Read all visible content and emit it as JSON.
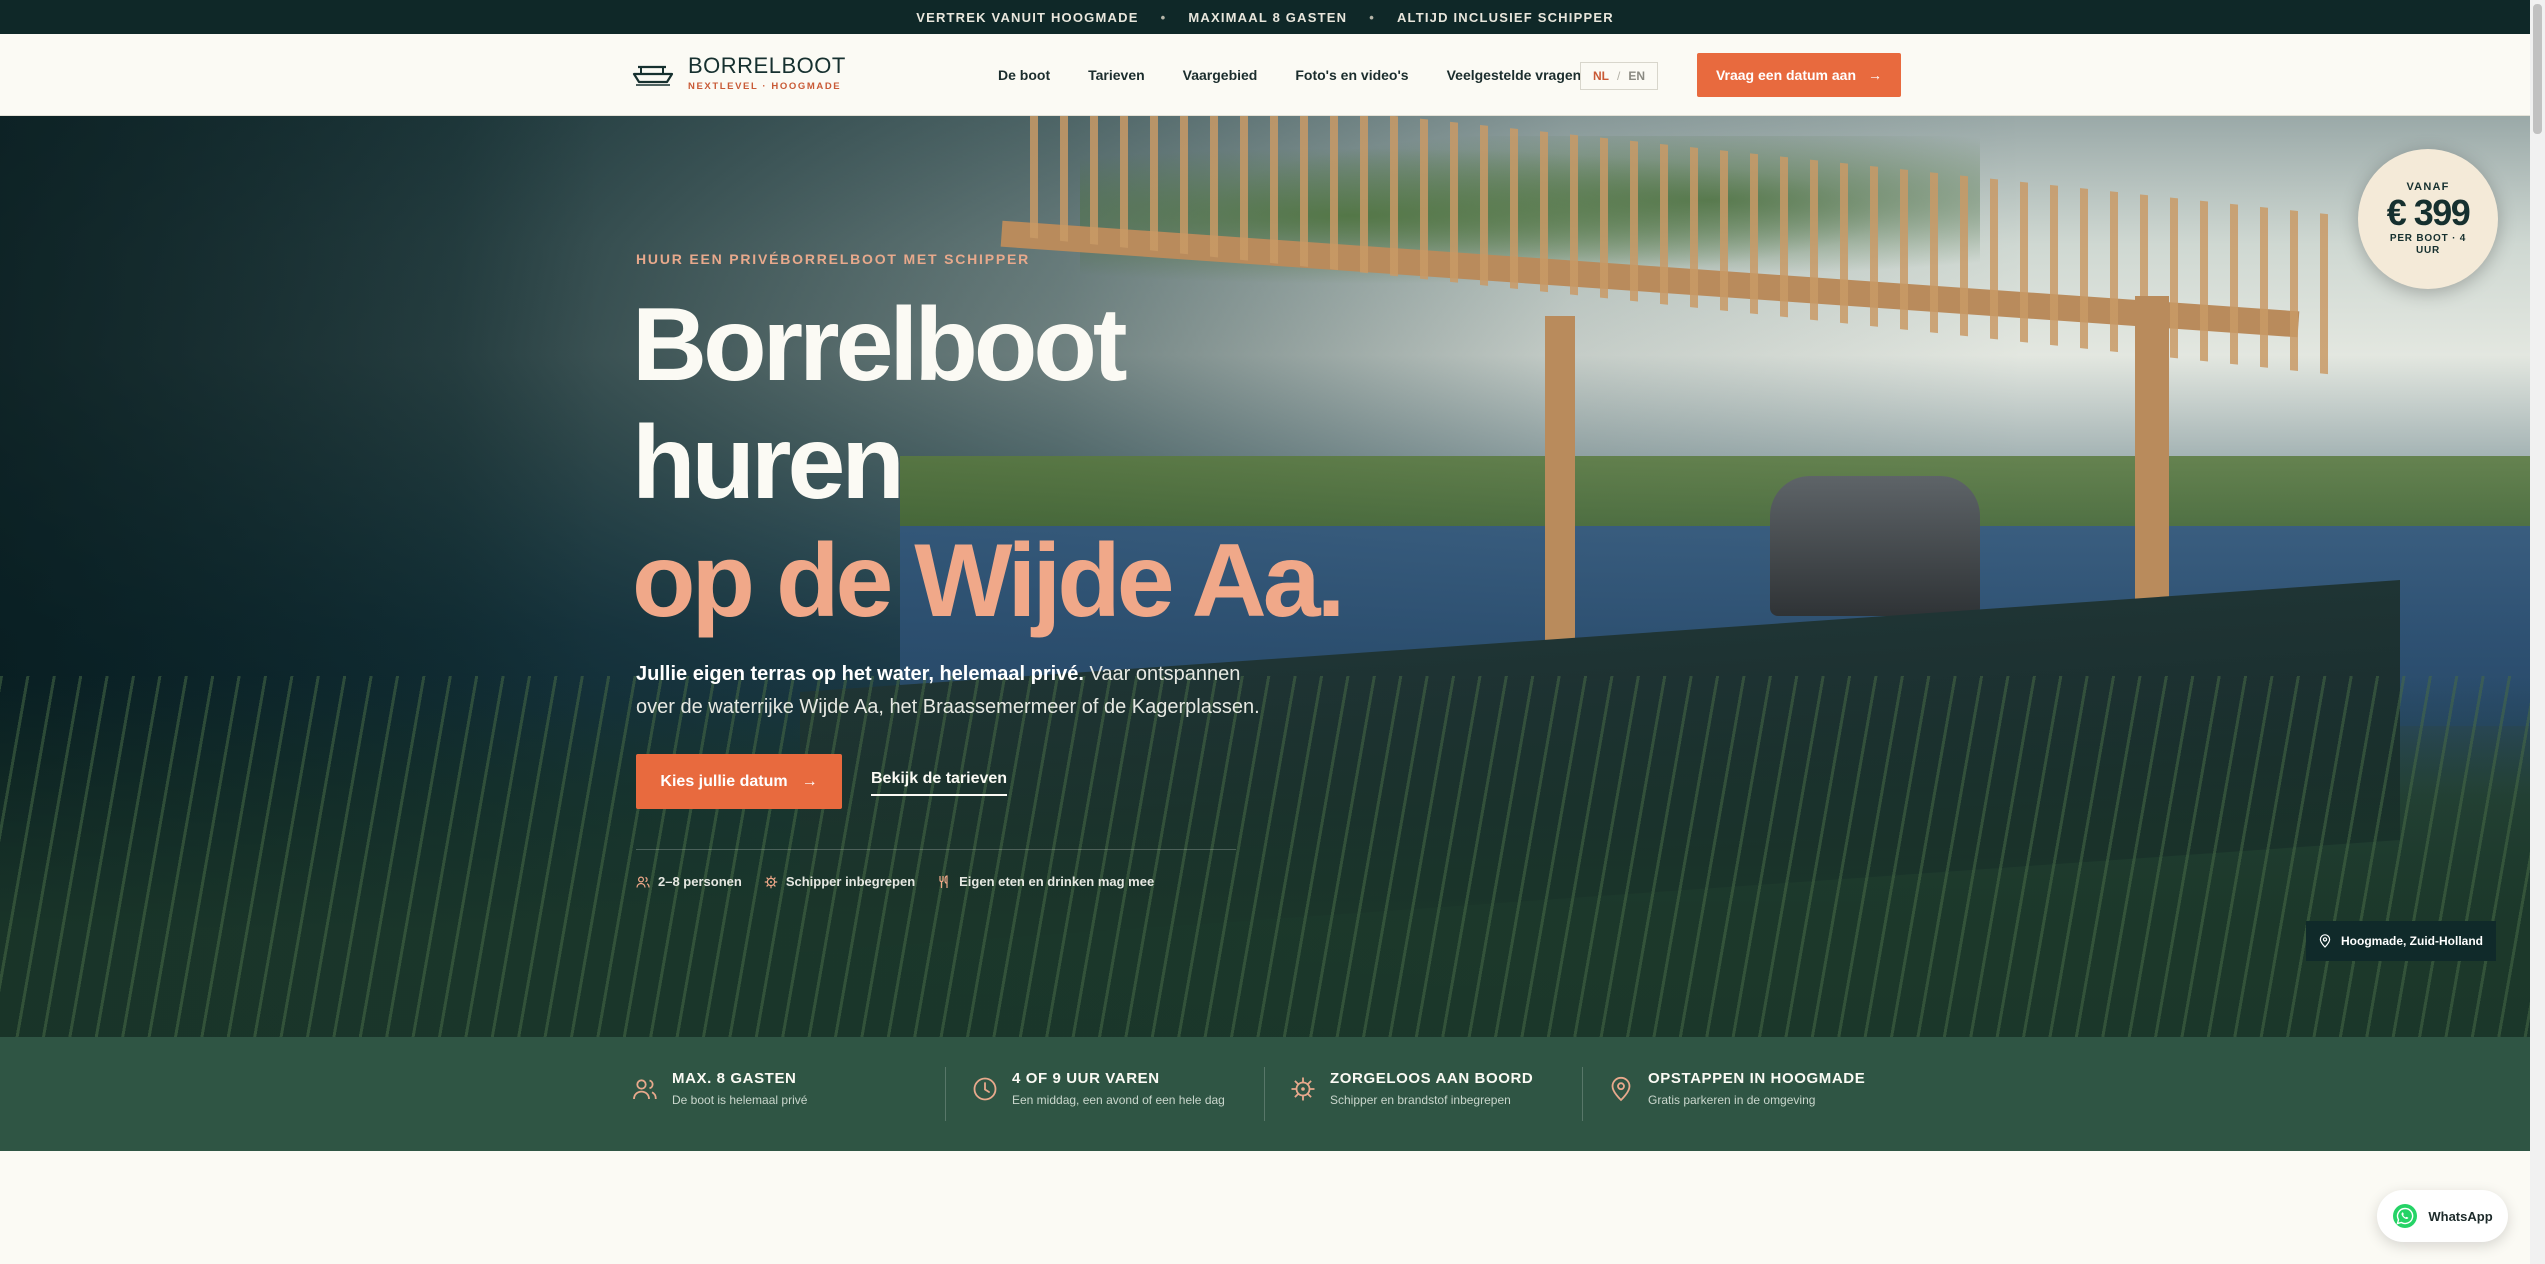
{
  "topbar": {
    "items": [
      "VERTREK VANUIT HOOGMADE",
      "MAXIMAAL 8 GASTEN",
      "ALTIJD INCLUSIEF SCHIPPER"
    ]
  },
  "header": {
    "logo_title": "BORRELBOOT",
    "logo_sub": "NEXTLEVEL · HOOGMADE",
    "nav": [
      "De boot",
      "Tarieven",
      "Vaargebied",
      "Foto's en video's",
      "Veelgestelde vragen"
    ],
    "lang_nl": "NL",
    "lang_sep": "/",
    "lang_en": "EN",
    "cta": "Vraag een datum aan"
  },
  "hero": {
    "eyebrow": "HUUR EEN PRIVÉBORRELBOOT MET SCHIPPER",
    "title_line1": "Borrelboot",
    "title_line2": "huren",
    "title_accent": "op de Wijde Aa.",
    "lead_bold": "Jullie eigen terras op het water, helemaal privé.",
    "lead_rest": " Vaar ontspannen over de waterrijke Wijde Aa, het Braassemermeer of de Kagerplassen.",
    "btn_primary": "Kies jullie datum",
    "btn_link": "Bekijk de tarieven",
    "features": [
      "2–8 personen",
      "Schipper inbegrepen",
      "Eigen eten en drinken mag mee"
    ],
    "price": {
      "from": "VANAF",
      "amount": "€ 399",
      "per": "PER BOOT · 4 UUR"
    },
    "location": "Hoogmade, Zuid-Holland"
  },
  "stats": [
    {
      "title": "MAX. 8 GASTEN",
      "sub": "De boot is helemaal privé",
      "icon": "users-icon"
    },
    {
      "title": "4 OF 9 UUR VAREN",
      "sub": "Een middag, een avond of een hele dag",
      "icon": "clock-icon"
    },
    {
      "title": "ZORGELOOS AAN BOORD",
      "sub": "Schipper en brandstof inbegrepen",
      "icon": "helm-icon"
    },
    {
      "title": "OPSTAPPEN IN HOOGMADE",
      "sub": "Gratis parkeren in de omgeving",
      "icon": "pin-icon"
    }
  ],
  "whatsapp": "WhatsApp",
  "colors": {
    "accent": "#e86a3e",
    "accent_light": "#f0a889",
    "dark": "#0f2828",
    "green_band": "#2f5544",
    "cream": "#fbfaf4"
  }
}
